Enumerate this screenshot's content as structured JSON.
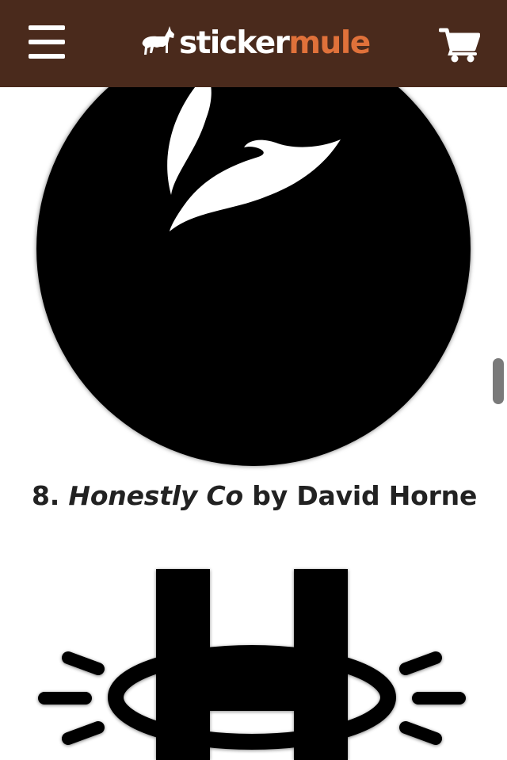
{
  "header": {
    "logo_part1": "sticker",
    "logo_part2": "mule",
    "menu_icon": "hamburger-menu-icon",
    "cart_icon": "shopping-cart-icon",
    "brand_color": "#4a2a1c",
    "accent_color": "#e0713a"
  },
  "article": {
    "item_number": "8.",
    "item_title": "Honestly Co",
    "item_by": "by David Horne"
  }
}
